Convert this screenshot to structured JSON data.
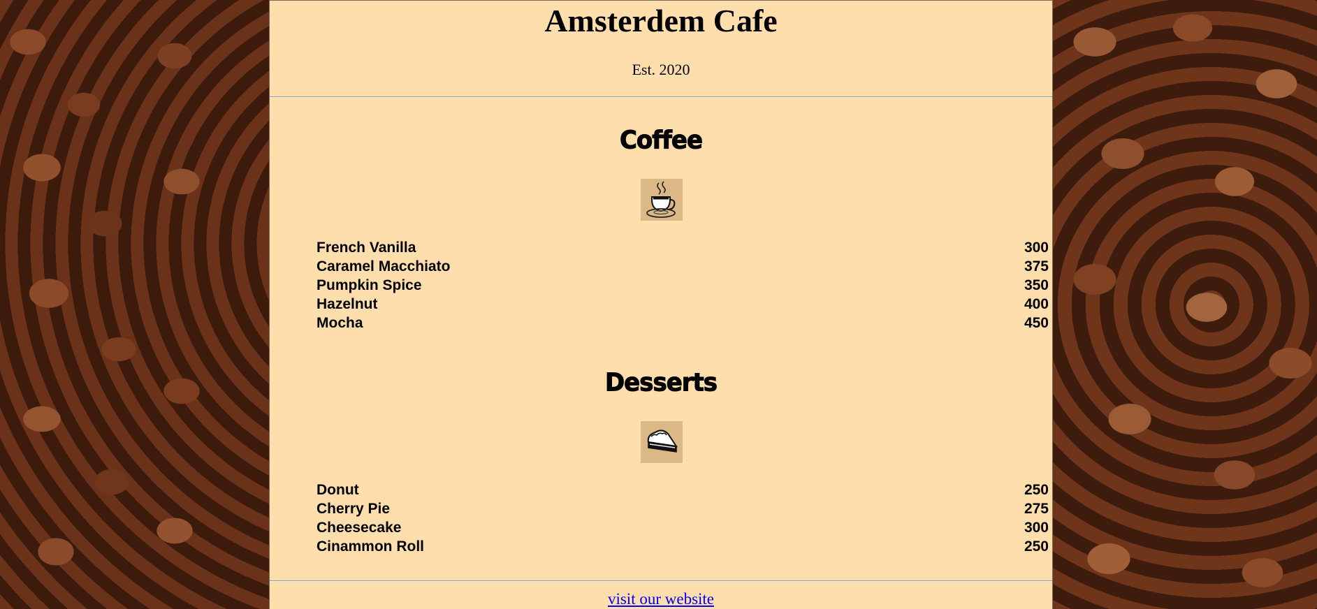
{
  "header": {
    "title": "Amsterdem Cafe",
    "established": "Est. 2020"
  },
  "sections": {
    "coffee": {
      "title": "Coffee",
      "icon": "coffee-cup-icon",
      "items": [
        {
          "name": "French Vanilla",
          "price": "300"
        },
        {
          "name": "Caramel Macchiato",
          "price": "375"
        },
        {
          "name": "Pumpkin Spice",
          "price": "350"
        },
        {
          "name": "Hazelnut",
          "price": "400"
        },
        {
          "name": "Mocha",
          "price": "450"
        }
      ]
    },
    "desserts": {
      "title": "Desserts",
      "icon": "pie-slice-icon",
      "items": [
        {
          "name": "Donut",
          "price": "250"
        },
        {
          "name": "Cherry Pie",
          "price": "275"
        },
        {
          "name": "Cheesecake",
          "price": "300"
        },
        {
          "name": "Cinammon Roll",
          "price": "250"
        }
      ]
    }
  },
  "footer": {
    "link_text": "visit our website"
  },
  "colors": {
    "menu_background": "#ffdead",
    "icon_background": "#dcb887",
    "link": "#0000ee"
  }
}
